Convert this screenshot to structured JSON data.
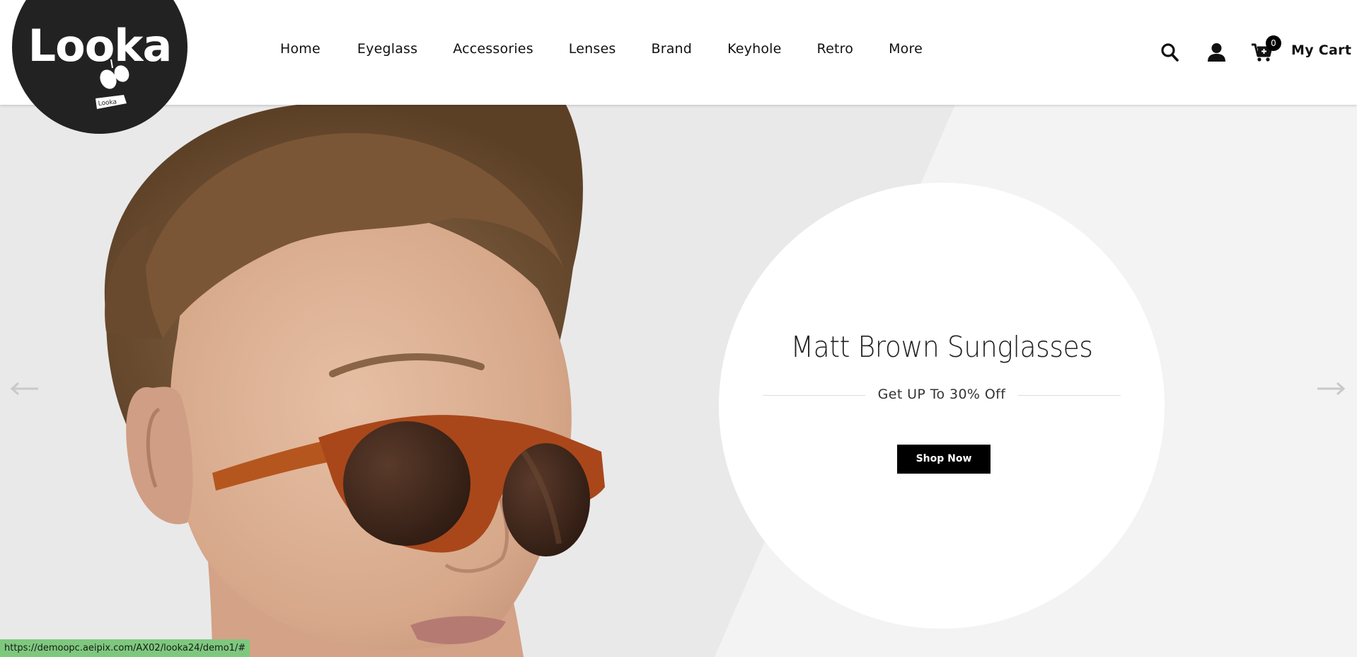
{
  "logo": {
    "text": "Looka",
    "tag_text": "Looka"
  },
  "nav": {
    "items": [
      {
        "label": "Home"
      },
      {
        "label": "Eyeglass"
      },
      {
        "label": "Accessories"
      },
      {
        "label": "Lenses"
      },
      {
        "label": "Brand"
      },
      {
        "label": "Keyhole"
      },
      {
        "label": "Retro"
      },
      {
        "label": "More"
      }
    ]
  },
  "header": {
    "icons": [
      "search-icon",
      "user-icon",
      "cart-icon"
    ],
    "cart_count": "0",
    "cart_label": "My Cart"
  },
  "hero": {
    "title": "Matt Brown Sunglasses",
    "subtitle": "Get UP To 30% Off",
    "button_label": "Shop Now",
    "prev_icon": "arrow-left-icon",
    "next_icon": "arrow-right-icon"
  },
  "status_bar": {
    "url": "https://demoopc.aeipix.com/AX02/looka24/demo1/#"
  },
  "colors": {
    "logo_bg": "#222222",
    "button_bg": "#000000",
    "status_bg": "#7ec87e",
    "hero_left_bg": "#e8e8e8",
    "hero_right_bg": "#f3f3f3"
  }
}
